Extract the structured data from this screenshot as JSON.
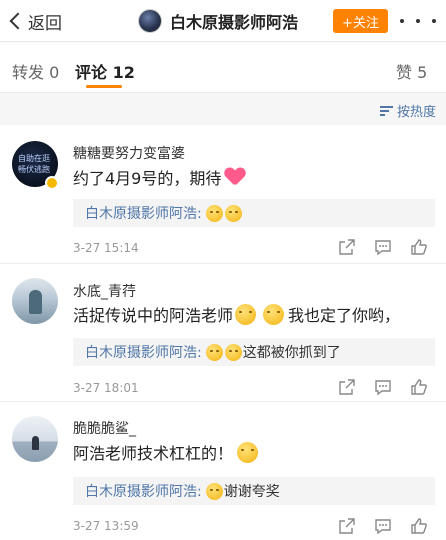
{
  "header": {
    "back_label": "返回",
    "title": "白木原摄影师阿浩",
    "follow_label": "+关注"
  },
  "tabs": [
    {
      "label": "转发 0"
    },
    {
      "label": "评论 12"
    },
    {
      "label": "赞 5"
    }
  ],
  "sort_label": "按热度",
  "comments": [
    {
      "user": "糖糖要努力变富婆",
      "avatar_text": "自助在逛 畅伏逃跑",
      "text": "约了4月9号的，期待",
      "text_emoji": "heart",
      "reply_user": "白木原摄影师阿浩:",
      "reply_text": "",
      "time": "3-27 15:14"
    },
    {
      "user": "水底_青荇",
      "text_before": "活捉传说中的阿浩老师",
      "text_after": "我也定了你哟，",
      "reply_user": "白木原摄影师阿浩:",
      "reply_text": "这都被你抓到了",
      "time": "3-27 18:01"
    },
    {
      "user": "脆脆脆鲨_",
      "text": "阿浩老师技术杠杠的！",
      "reply_user": "白木原摄影师阿浩:",
      "reply_text": "谢谢夸奖",
      "time": "3-27 13:59"
    }
  ],
  "icons": [
    "back-chevron-icon",
    "more-icon",
    "sort-icon",
    "share-icon",
    "comment-icon",
    "like-icon",
    "verified-badge-icon",
    "smile-emoji-icon",
    "heart-emoji-icon"
  ],
  "colors": {
    "accent": "#ff8200",
    "link": "#5077a8",
    "badge": "#f5b800"
  }
}
